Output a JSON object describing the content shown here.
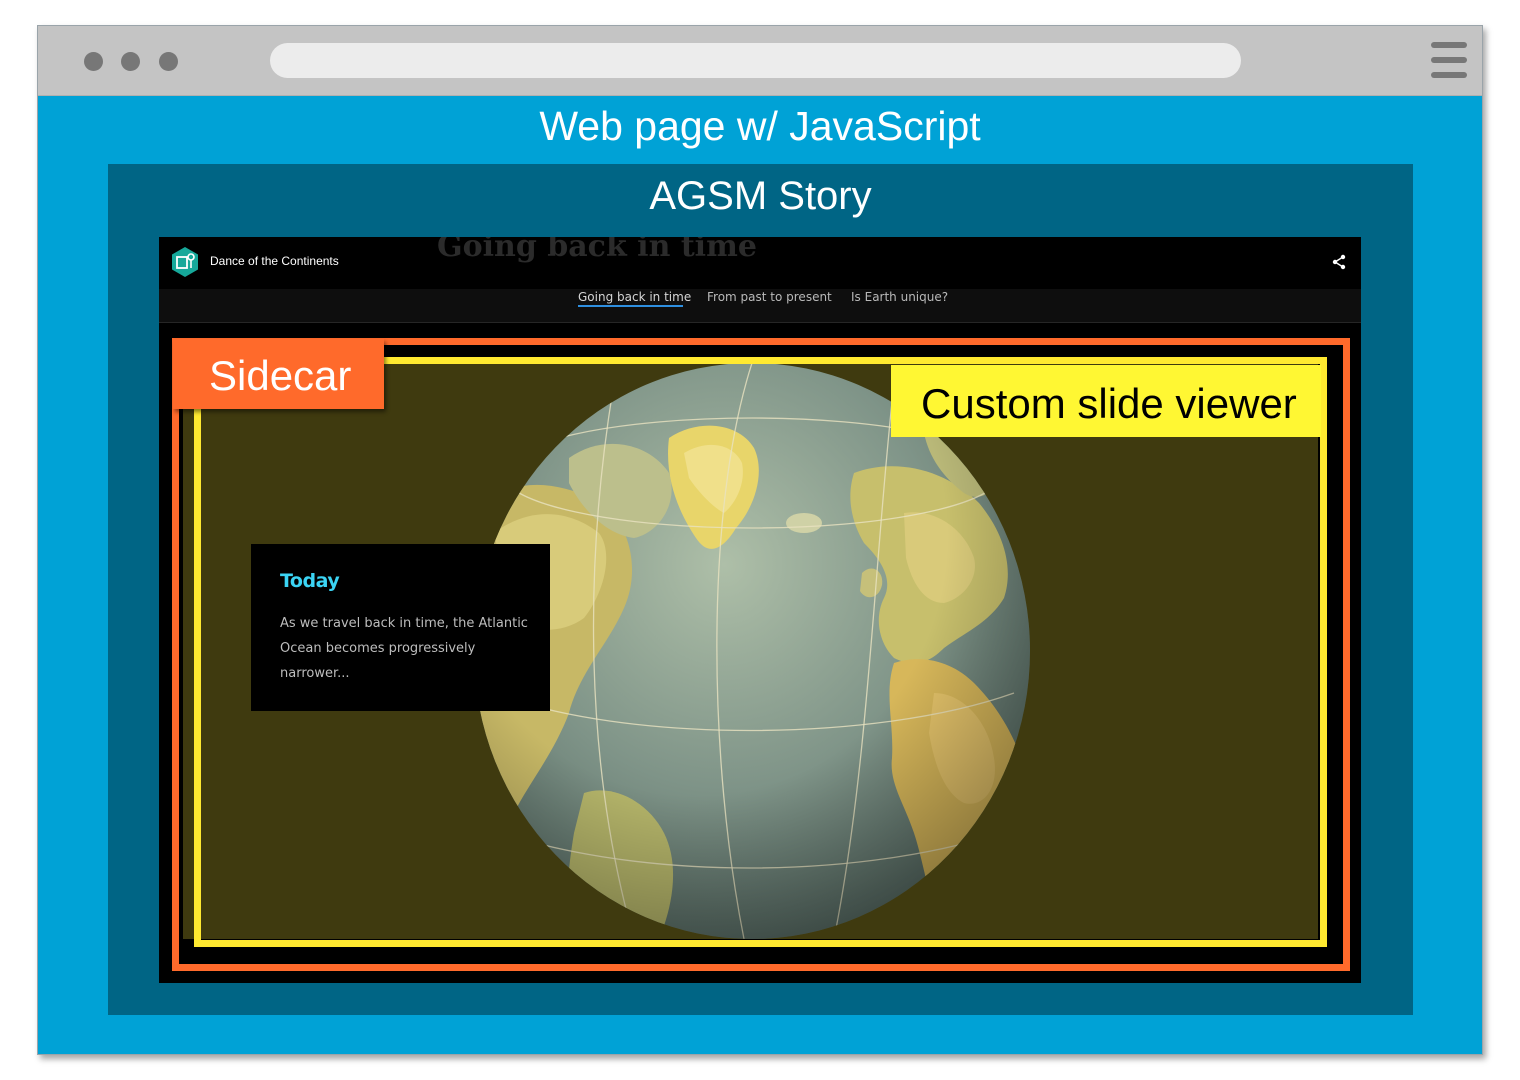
{
  "page": {
    "title": "Web page w/ JavaScript"
  },
  "story": {
    "title": "AGSM Story",
    "app": {
      "title": "Dance of the Continents",
      "background_heading": "Going back in time",
      "nav_tabs": [
        {
          "label": "Going back in time",
          "active": true
        },
        {
          "label": "From past to present",
          "active": false
        },
        {
          "label": "Is Earth unique?",
          "active": false
        }
      ]
    },
    "slide": {
      "heading": "Today",
      "body": "As we travel back in time, the Atlantic Ocean becomes progressively narrower..."
    }
  },
  "labels": {
    "sidecar": "Sidecar",
    "viewer": "Custom slide viewer"
  },
  "colors": {
    "page_background": "#00a2d6",
    "story_background": "#006585",
    "sidecar_frame": "#ff6a2b",
    "viewer_frame": "#ffe930",
    "caption_heading": "#3bd4f4",
    "nav_active_underline": "#2e8fe0"
  },
  "icons": {
    "window_controls": "traffic-light-dots",
    "menu": "hamburger-icon",
    "app_logo": "story-map-icon",
    "share": "share-icon"
  }
}
